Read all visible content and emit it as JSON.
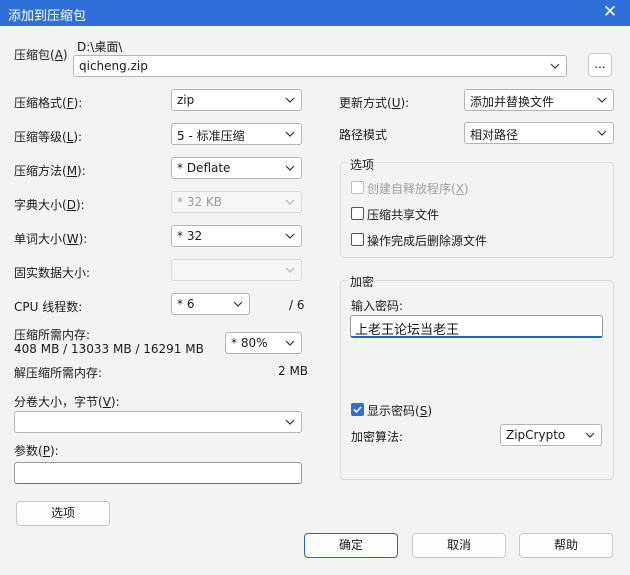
{
  "window": {
    "title": "添加到压缩包",
    "close_glyph": "✕"
  },
  "archive": {
    "label": "压缩包(",
    "key": "A",
    "label_end": ")",
    "path": "D:\\桌面\\",
    "filename": "qicheng.zip",
    "browse": "..."
  },
  "format": {
    "label": "压缩格式(",
    "key": "F",
    "label_end": "):",
    "value": "zip"
  },
  "level": {
    "label": "压缩等级(",
    "key": "L",
    "label_end": "):",
    "value": "5 - 标准压缩"
  },
  "method": {
    "label": "压缩方法(",
    "key": "M",
    "label_end": "):",
    "value": "* Deflate"
  },
  "dict": {
    "label": "字典大小(",
    "key": "D",
    "label_end": "):",
    "value": "* 32 KB"
  },
  "word": {
    "label": "单词大小(",
    "key": "W",
    "label_end": "):",
    "value": "* 32"
  },
  "solid": {
    "label": "固实数据大小:",
    "value": ""
  },
  "threads": {
    "label": "CPU 线程数:",
    "value": "* 6",
    "total": "/ 6"
  },
  "mem_comp": {
    "label": "压缩所需内存:",
    "info": "408 MB / 13033 MB / 16291 MB",
    "value": "* 80%"
  },
  "mem_decomp": {
    "label": "解压缩所需内存:",
    "value": "2 MB"
  },
  "volume": {
    "label": "分卷大小，字节(",
    "key": "V",
    "label_end": "):",
    "value": ""
  },
  "params": {
    "label": "参数(",
    "key": "P",
    "label_end": "):",
    "value": ""
  },
  "options_button": "选项",
  "update": {
    "label": "更新方式(",
    "key": "U",
    "label_end": "):",
    "value": "添加并替换文件"
  },
  "pathmode": {
    "label": "路径模式",
    "value": "相对路径"
  },
  "options_group": {
    "title": "选项",
    "sfx": {
      "label": "创建自释放程序(",
      "key": "X",
      "label_end": ")"
    },
    "shared": {
      "label": "压缩共享文件"
    },
    "delete": {
      "label": "操作完成后删除源文件"
    }
  },
  "encrypt": {
    "title": "加密",
    "pwd_label": "输入密码:",
    "pwd_value": "上老王论坛当老王",
    "show_label": "显示密码(",
    "show_key": "S",
    "show_end": ")",
    "method_label": "加密算法:",
    "method_value": "ZipCrypto"
  },
  "buttons": {
    "ok": "确定",
    "cancel": "取消",
    "help": "帮助"
  },
  "colors": {
    "titlebar": "#2f70d8",
    "accent": "#2f6fd1",
    "background": "#f3f3f3"
  }
}
